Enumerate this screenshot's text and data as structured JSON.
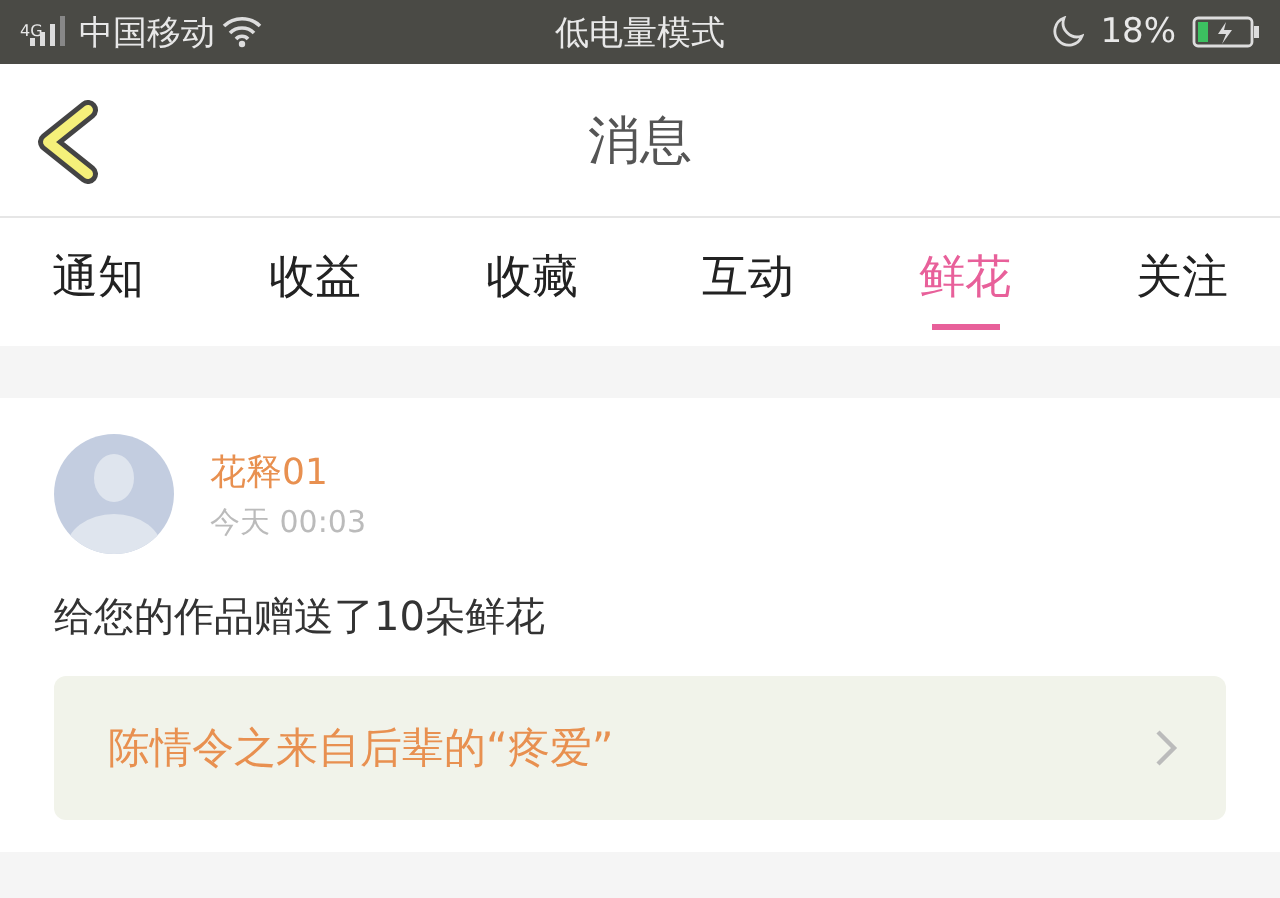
{
  "status_bar": {
    "network": "4G",
    "carrier": "中国移动",
    "mode": "低电量模式",
    "battery": "18%"
  },
  "header": {
    "title": "消息"
  },
  "tabs": [
    {
      "label": "通知",
      "selected": false
    },
    {
      "label": "收益",
      "selected": false
    },
    {
      "label": "收藏",
      "selected": false
    },
    {
      "label": "互动",
      "selected": false
    },
    {
      "label": "鲜花",
      "selected": true
    },
    {
      "label": "关注",
      "selected": false
    }
  ],
  "messages": [
    {
      "user": "花释01",
      "time": "今天 00:03",
      "text": "给您的作品赠送了10朵鲜花",
      "work": "陈情令之来自后辈的“疼爱”"
    }
  ]
}
